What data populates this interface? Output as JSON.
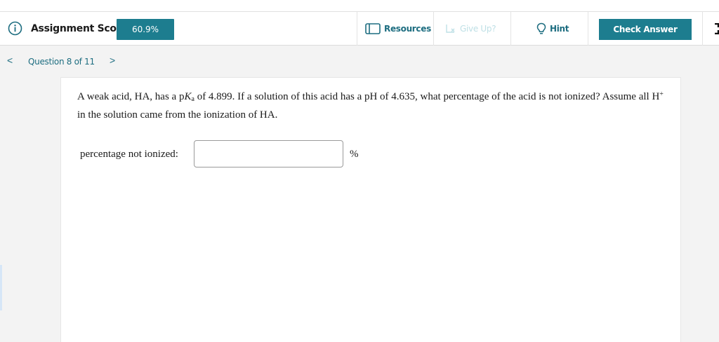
{
  "toolbar": {
    "score_label": "Assignment Score:",
    "score_value": "60.9%",
    "resources_label": "Resources",
    "giveup_label": "Give Up?",
    "hint_label": "Hint",
    "check_answer_label": "Check Answer"
  },
  "icons": {
    "info": "info-circle-icon",
    "resources": "book-icon",
    "giveup": "give-up-icon",
    "hint": "lightbulb-icon",
    "expand": "expand-icon",
    "prev": "chevron-left-icon",
    "next": "chevron-right-icon"
  },
  "nav": {
    "prev_glyph": "<",
    "question_label": "Question 8 of 11",
    "next_glyph": ">"
  },
  "question": {
    "t1": "A weak acid, HA, has a p",
    "K": "K",
    "a_sub": "a",
    "t2": " of 4.899. If a solution of this acid has a pH of 4.635, what percentage of the acid is not ionized? Assume all H",
    "plus_sup": "+",
    "t3": " in the solution came from the ionization of HA."
  },
  "answer": {
    "label": "percentage not ionized:",
    "value": "",
    "placeholder": "",
    "unit": "%"
  },
  "colors": {
    "accent": "#1d7d8f",
    "link": "#1d6d80",
    "disabled": "#bfe0e6",
    "background": "#f3f3f3"
  }
}
